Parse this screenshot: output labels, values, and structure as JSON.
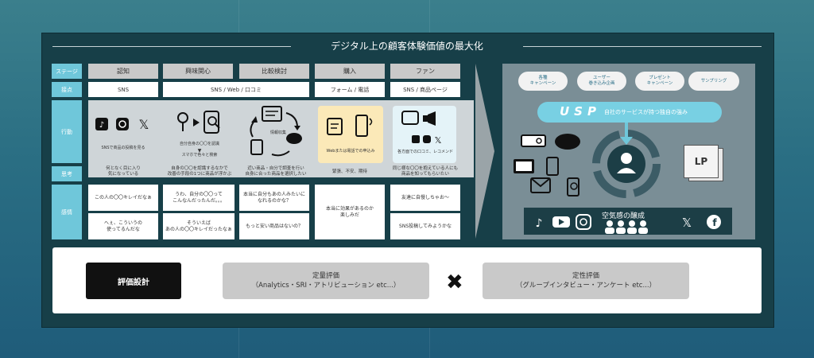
{
  "title": "デジタル上の顧客体験価値の最大化",
  "rows": {
    "stage": "ステージ",
    "touchpoint": "接点",
    "action": "行動",
    "thought": "思考",
    "emotion": "感情"
  },
  "stages": [
    "認知",
    "興味関心",
    "比較検討",
    "購入",
    "ファン"
  ],
  "touchpoints": {
    "sns": "SNS",
    "web": "SNS / Web / 口コミ",
    "form": "フォーム / 電話",
    "fan": "SNS / 商品ページ"
  },
  "actions": {
    "a1": "SNSで商品の投稿を見る",
    "a2_1": "自分自身の〇〇を認識",
    "a2_2": "スマホで色々と検索",
    "a3": "情報収集",
    "a4": "Webまたは電話での申込み",
    "a5": "各方面での口コミ、レコメンド"
  },
  "thoughts": {
    "t1": "何となく目に入り\n気になっている",
    "t2": "自身の〇〇を認識するなかで\n改善の手段の1つに商品が浮かぶ",
    "t3": "近い商品・自分で調査を行い\n自身に合った商品を選択したい",
    "t4": "緊張、不安、期待",
    "t5": "同じ様な〇〇を抱えている人にも\n商品を知ってもらいたい"
  },
  "emotions": {
    "e1a": "この人の〇〇キレイだなぁ",
    "e1b": "へぇ、こういうの\n使ってるんだな",
    "e2a": "うわ、自分の〇〇って\nこんなんだったんだ。。。",
    "e2b": "そういえば\nあの人の〇〇キレイだったなぁ",
    "e3a": "本当に自分もあの人みたいに\nなれるのかな？",
    "e3b": "もっと安い商品はないの？",
    "e4": "本当に効果があるのか\n楽しみだ",
    "e5a": "友達に自慢しちゃお〜",
    "e5b": "SNS投稿してみようかな"
  },
  "bubbles": [
    "各種\nキャンペーン",
    "ユーザー\n巻き込み企画",
    "プレゼント\nキャンペーン",
    "サンプリング"
  ],
  "usp": {
    "label": "USP",
    "subtitle": "自社のサービスが持つ独自の強み"
  },
  "lp": "LP",
  "social_text": "空気感の醸成",
  "bottom": {
    "eval_design": "評価設計",
    "quant_title": "定量評価",
    "quant_sub": "（Analytics・SRI・アトリビューション etc...）",
    "qual_title": "定性評価",
    "qual_sub": "（グループインタビュー・アンケート etc...）",
    "cross": "✖"
  },
  "colors": {
    "accent_cyan": "#6fc7da",
    "panel": "#173f48",
    "highlight_yellow": "#fbe9b8",
    "highlight_blue": "#e4f3f8"
  }
}
